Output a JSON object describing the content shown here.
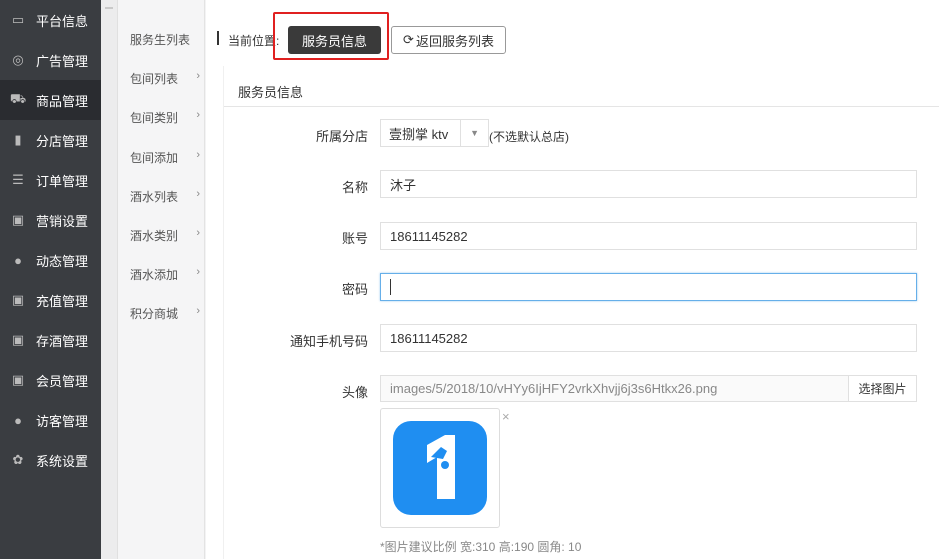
{
  "sidebar": {
    "items": [
      {
        "label": "平台信息",
        "icon": "monitor-icon",
        "active": false
      },
      {
        "label": "广告管理",
        "icon": "lifebuoy-icon",
        "active": false
      },
      {
        "label": "商品管理",
        "icon": "cart-icon",
        "active": true
      },
      {
        "label": "分店管理",
        "icon": "book-icon",
        "active": false
      },
      {
        "label": "订单管理",
        "icon": "list-icon",
        "active": false
      },
      {
        "label": "营销设置",
        "icon": "gift-icon",
        "active": false
      },
      {
        "label": "动态管理",
        "icon": "user-icon",
        "active": false
      },
      {
        "label": "充值管理",
        "icon": "gift-icon",
        "active": false
      },
      {
        "label": "存酒管理",
        "icon": "gift-icon",
        "active": false
      },
      {
        "label": "会员管理",
        "icon": "gift-icon",
        "active": false
      },
      {
        "label": "访客管理",
        "icon": "user-icon",
        "active": false
      },
      {
        "label": "系统设置",
        "icon": "gear-icon",
        "active": false
      }
    ]
  },
  "submenu": {
    "items": [
      {
        "label": "服务生列表",
        "arrow": ""
      },
      {
        "label": "包间列表",
        "arrow": "›"
      },
      {
        "label": "包间类别",
        "arrow": "›"
      },
      {
        "label": "包间添加",
        "arrow": "›"
      },
      {
        "label": "酒水列表",
        "arrow": "›"
      },
      {
        "label": "酒水类别",
        "arrow": "›"
      },
      {
        "label": "酒水添加",
        "arrow": "›"
      },
      {
        "label": "积分商城",
        "arrow": "›"
      }
    ]
  },
  "header": {
    "crumb_label": "当前位置:",
    "current_button": "服务员信息",
    "back_button": "返回服务列表",
    "back_icon": "refresh-icon"
  },
  "form": {
    "title": "服务员信息",
    "branch_label": "所属分店",
    "branch_value": "壹捌掌 ktv",
    "branch_hint": "(不选默认总店)",
    "name_label": "名称",
    "name_value": "沐子",
    "account_label": "账号",
    "account_value": "18611145282",
    "password_label": "密码",
    "password_value": "",
    "phone_label": "通知手机号码",
    "phone_value": "18611145282",
    "avatar_label": "头像",
    "avatar_path": "images/5/2018/10/vHYy6IjHFY2vrkXhvjj6j3s6Htkx26.png",
    "pick_image_button": "选择图片",
    "remove_mark": "×",
    "image_note": "*图片建议比例 宽:310 高:190 圆角: 10"
  },
  "colors": {
    "sidebar_bg": "#3a3d41",
    "highlight_border": "#e02020",
    "logo_blue": "#1f8ef1"
  }
}
